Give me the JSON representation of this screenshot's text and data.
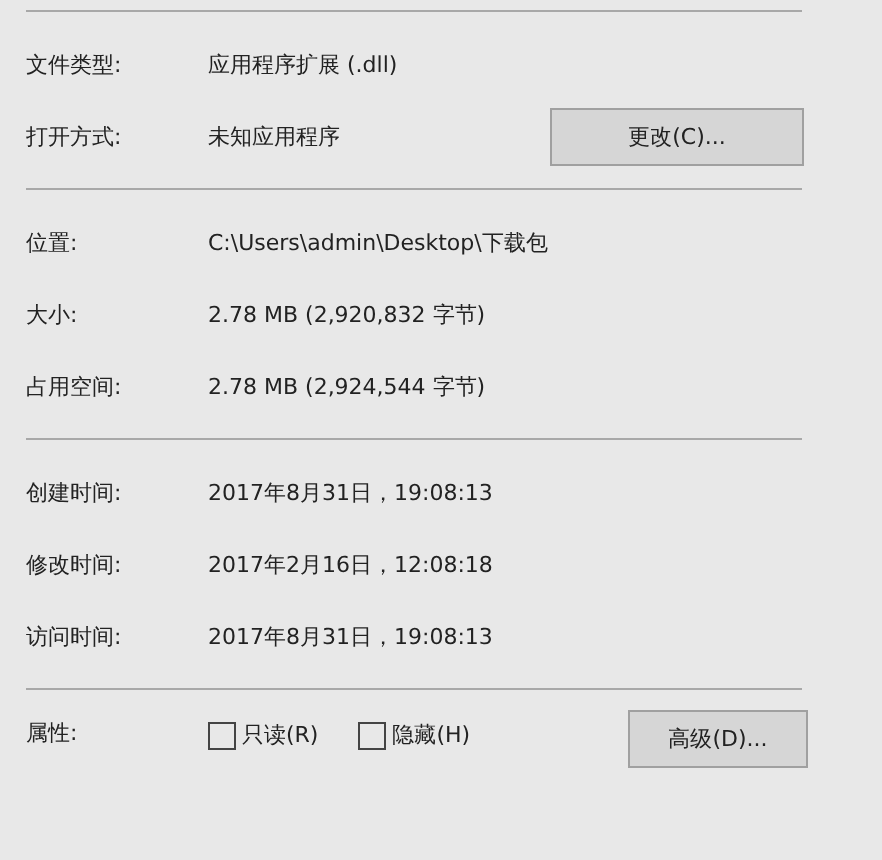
{
  "sections": [
    {
      "rows": [
        {
          "label": "文件类型:",
          "value": "应用程序扩展 (.dll)"
        },
        {
          "label": "打开方式:",
          "value": "未知应用程序",
          "button": "更改(C)..."
        }
      ]
    },
    {
      "rows": [
        {
          "label": "位置:",
          "value": "C:\\Users\\admin\\Desktop\\下载包"
        },
        {
          "label": "大小:",
          "value": "2.78 MB (2,920,832 字节)"
        },
        {
          "label": "占用空间:",
          "value": "2.78 MB (2,924,544 字节)"
        }
      ]
    },
    {
      "rows": [
        {
          "label": "创建时间:",
          "value": "2017年8月31日，19:08:13"
        },
        {
          "label": "修改时间:",
          "value": "2017年2月16日，12:08:18"
        },
        {
          "label": "访问时间:",
          "value": "2017年8月31日，19:08:13"
        }
      ]
    }
  ],
  "attributes": {
    "label": "属性:",
    "checkboxes": [
      {
        "label": "只读(R)",
        "checked": false
      },
      {
        "label": "隐藏(H)",
        "checked": false
      }
    ],
    "button": "高级(D)..."
  }
}
